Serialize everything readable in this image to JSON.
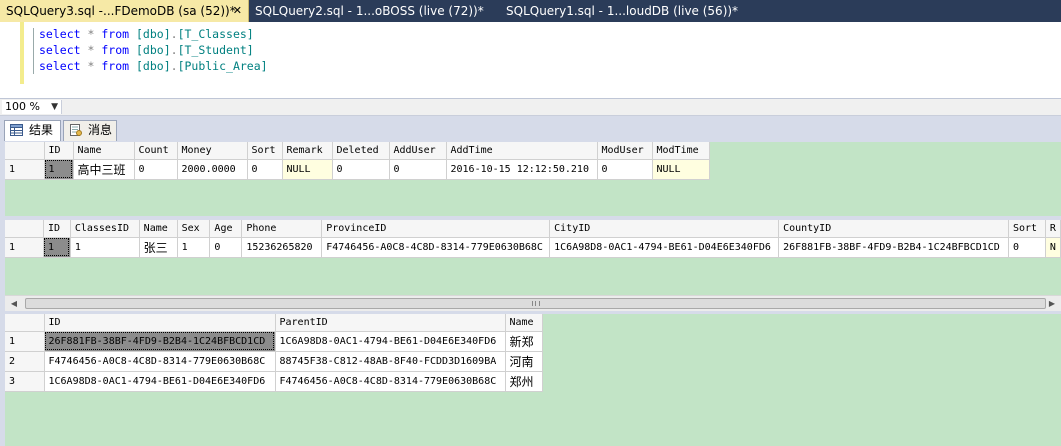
{
  "tabs": [
    {
      "label": "SQLQuery3.sql -...FDemoDB (sa (52))*",
      "active": true
    },
    {
      "label": "SQLQuery2.sql - 1...oBOSS (live (72))*",
      "active": false
    },
    {
      "label": "SQLQuery1.sql - 1...loudDB (live (56))*",
      "active": false
    }
  ],
  "editor": {
    "lines": [
      {
        "kw": "select",
        "star": "*",
        "from": "from",
        "schema": "[dbo]",
        "dot": ".",
        "table": "[T_Classes]"
      },
      {
        "kw": "select",
        "star": "*",
        "from": "from",
        "schema": "[dbo]",
        "dot": ".",
        "table": "[T_Student]"
      },
      {
        "kw": "select",
        "star": "*",
        "from": "from",
        "schema": "[dbo]",
        "dot": ".",
        "table": "[Public_Area]"
      }
    ]
  },
  "zoom": "100 %",
  "result_tabs": {
    "results": "结果",
    "messages": "消息"
  },
  "grid1": {
    "columns": [
      "ID",
      "Name",
      "Count",
      "Money",
      "Sort",
      "Remark",
      "Deleted",
      "AddUser",
      "AddTime",
      "ModUser",
      "ModTime"
    ],
    "rows": [
      {
        "rn": "1",
        "cells": [
          "1",
          "高中三班",
          "0",
          "2000.0000",
          "0",
          "NULL",
          "0",
          "0",
          "2016-10-15 12:12:50.210",
          "0",
          "NULL"
        ]
      }
    ]
  },
  "grid2": {
    "columns": [
      "ID",
      "ClassesID",
      "Name",
      "Sex",
      "Age",
      "Phone",
      "ProvinceID",
      "CityID",
      "CountyID",
      "Sort",
      "R"
    ],
    "rows": [
      {
        "rn": "1",
        "cells": [
          "1",
          "1",
          "张三",
          "1",
          "0",
          "15236265820",
          "F4746456-A0C8-4C8D-8314-779E0630B68C",
          "1C6A98D8-0AC1-4794-BE61-D04E6E340FD6",
          "26F881FB-38BF-4FD9-B2B4-1C24BFBCD1CD",
          "0",
          "N"
        ]
      }
    ]
  },
  "grid3": {
    "columns": [
      "ID",
      "ParentID",
      "Name"
    ],
    "rows": [
      {
        "rn": "1",
        "cells": [
          "26F881FB-38BF-4FD9-B2B4-1C24BFBCD1CD",
          "1C6A98D8-0AC1-4794-BE61-D04E6E340FD6",
          "新郑"
        ]
      },
      {
        "rn": "2",
        "cells": [
          "F4746456-A0C8-4C8D-8314-779E0630B68C",
          "88745F38-C812-48AB-8F40-FCDD3D1609BA",
          "河南"
        ]
      },
      {
        "rn": "3",
        "cells": [
          "1C6A98D8-0AC1-4794-BE61-D04E6E340FD6",
          "F4746456-A0C8-4C8D-8314-779E0630B68C",
          "郑州"
        ]
      }
    ]
  },
  "icons": {
    "results_tab": "grid-icon",
    "messages_tab": "document-icon",
    "close": "close-icon"
  },
  "colors": {
    "active_tab": "#f6e9a6",
    "tabstrip": "#2b3c59",
    "pane_bg": "#c2e4c6",
    "keyword": "#0000ff",
    "object": "#008080",
    "null_cell": "#fffee0"
  }
}
